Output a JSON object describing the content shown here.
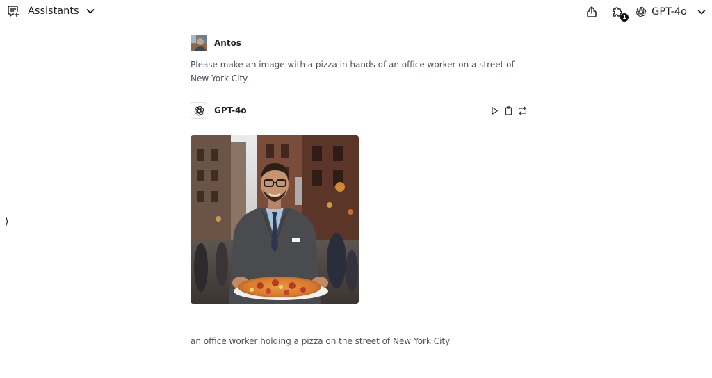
{
  "header": {
    "assistants_label": "Assistants",
    "plugin_badge": "1",
    "model_name": "GPT-4o"
  },
  "sidebar": {
    "expand_glyph": "⟩"
  },
  "messages": [
    {
      "author": "Antos",
      "text": "Please make an image with a pizza in hands of an office worker on a street of New York City."
    },
    {
      "author": "GPT-4o",
      "image_alt": "an office worker holding a pizza on the street of New York City",
      "caption": "an office worker holding a pizza on the street of New York City"
    }
  ],
  "icons": {
    "header_left": "new-chat-icon",
    "share": "share-icon",
    "plugins": "puzzle-icon",
    "model": "openai-logo-icon",
    "actions": [
      "play-icon",
      "clipboard-icon",
      "regenerate-icon"
    ]
  },
  "colors": {
    "text": "#1f2328",
    "muted_text": "#4a4f57",
    "badge": "#111111"
  }
}
